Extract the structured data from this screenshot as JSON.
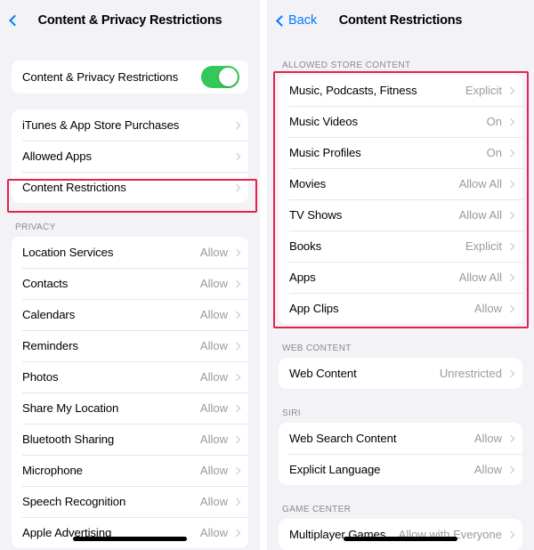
{
  "left_panel": {
    "nav": {
      "back_icon": "chevron-left-icon",
      "title": "Content & Privacy Restrictions"
    },
    "master_toggle": {
      "label": "Content & Privacy Restrictions",
      "state": "on",
      "color": "#34C759"
    },
    "restrictions_group": [
      {
        "label": "iTunes & App Store Purchases",
        "value": ""
      },
      {
        "label": "Allowed Apps",
        "value": ""
      },
      {
        "label": "Content Restrictions",
        "value": "",
        "highlighted": true
      }
    ],
    "privacy_header": "PRIVACY",
    "privacy_group": [
      {
        "label": "Location Services",
        "value": "Allow"
      },
      {
        "label": "Contacts",
        "value": "Allow"
      },
      {
        "label": "Calendars",
        "value": "Allow"
      },
      {
        "label": "Reminders",
        "value": "Allow"
      },
      {
        "label": "Photos",
        "value": "Allow"
      },
      {
        "label": "Share My Location",
        "value": "Allow"
      },
      {
        "label": "Bluetooth Sharing",
        "value": "Allow"
      },
      {
        "label": "Microphone",
        "value": "Allow"
      },
      {
        "label": "Speech Recognition",
        "value": "Allow"
      },
      {
        "label": "Apple Advertising",
        "value": "Allow"
      }
    ]
  },
  "right_panel": {
    "nav": {
      "back_icon": "chevron-left-icon",
      "back_label": "Back",
      "title": "Content Restrictions"
    },
    "store_header": "ALLOWED STORE CONTENT",
    "store_group": [
      {
        "label": "Music, Podcasts, Fitness",
        "value": "Explicit"
      },
      {
        "label": "Music Videos",
        "value": "On"
      },
      {
        "label": "Music Profiles",
        "value": "On"
      },
      {
        "label": "Movies",
        "value": "Allow All"
      },
      {
        "label": "TV Shows",
        "value": "Allow All"
      },
      {
        "label": "Books",
        "value": "Explicit"
      },
      {
        "label": "Apps",
        "value": "Allow All"
      },
      {
        "label": "App Clips",
        "value": "Allow"
      }
    ],
    "web_header": "WEB CONTENT",
    "web_group": [
      {
        "label": "Web Content",
        "value": "Unrestricted"
      }
    ],
    "siri_header": "SIRI",
    "siri_group": [
      {
        "label": "Web Search Content",
        "value": "Allow"
      },
      {
        "label": "Explicit Language",
        "value": "Allow"
      }
    ],
    "game_center_header": "GAME CENTER",
    "game_center_group": [
      {
        "label": "Multiplayer Games",
        "value": "Allow with Everyone"
      }
    ]
  },
  "annotation": {
    "highlight_color": "#E8214A"
  }
}
